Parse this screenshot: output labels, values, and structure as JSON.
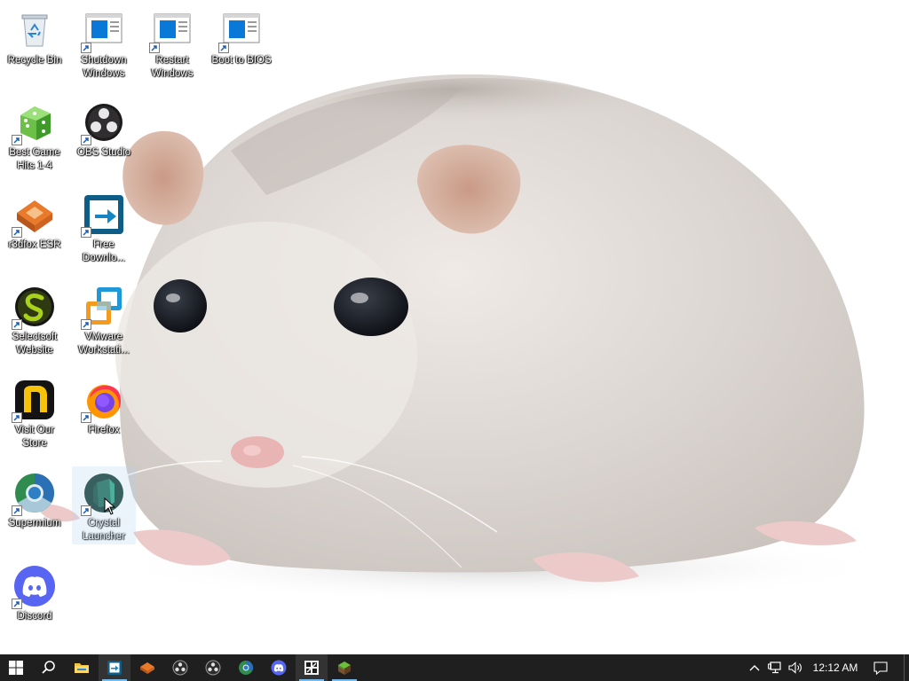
{
  "desktop": {
    "icons": [
      {
        "label": "Recycle Bin",
        "icon": "recycle-bin-icon"
      },
      {
        "label": "Shutdown Windows",
        "icon": "shutdown-shortcut-icon"
      },
      {
        "label": "Restart Windows",
        "icon": "restart-shortcut-icon"
      },
      {
        "label": "Boot to BIOS",
        "icon": "bios-shortcut-icon"
      },
      {
        "label": "Best Game Hits 1-4",
        "icon": "dice-icon"
      },
      {
        "label": "OBS Studio",
        "icon": "obs-icon"
      },
      {
        "label": "r3dfox ESR",
        "icon": "r3dfox-icon"
      },
      {
        "label": "Free Downlo...",
        "icon": "download-manager-icon"
      },
      {
        "label": "Selectsoft Website",
        "icon": "selectsoft-icon"
      },
      {
        "label": "VMware Workstati...",
        "icon": "vmware-icon"
      },
      {
        "label": "Visit Our Store",
        "icon": "store-icon"
      },
      {
        "label": "Firefox",
        "icon": "firefox-icon"
      },
      {
        "label": "Supermium",
        "icon": "supermium-icon"
      },
      {
        "label": "Crystal Launcher",
        "icon": "crystal-launcher-icon"
      },
      {
        "label": "Discord",
        "icon": "discord-icon"
      }
    ]
  },
  "taskbar": {
    "pinned": [
      {
        "name": "start-button",
        "icon": "windows-logo-icon"
      },
      {
        "name": "search-button",
        "icon": "search-icon"
      },
      {
        "name": "file-explorer",
        "icon": "folder-icon"
      },
      {
        "name": "download-manager",
        "icon": "download-manager-icon"
      },
      {
        "name": "r3dfox",
        "icon": "r3dfox-icon"
      },
      {
        "name": "obs-studio-1",
        "icon": "obs-icon"
      },
      {
        "name": "obs-studio-2",
        "icon": "obs-icon"
      },
      {
        "name": "supermium",
        "icon": "supermium-icon"
      },
      {
        "name": "discord",
        "icon": "discord-icon"
      },
      {
        "name": "app-window",
        "icon": "app-window-icon"
      },
      {
        "name": "minecraft",
        "icon": "grass-block-icon"
      }
    ],
    "tray": {
      "clock": "12:12 AM"
    }
  },
  "colors": {
    "taskbar": "#1f1f1f",
    "accent": "#76b9ed"
  }
}
